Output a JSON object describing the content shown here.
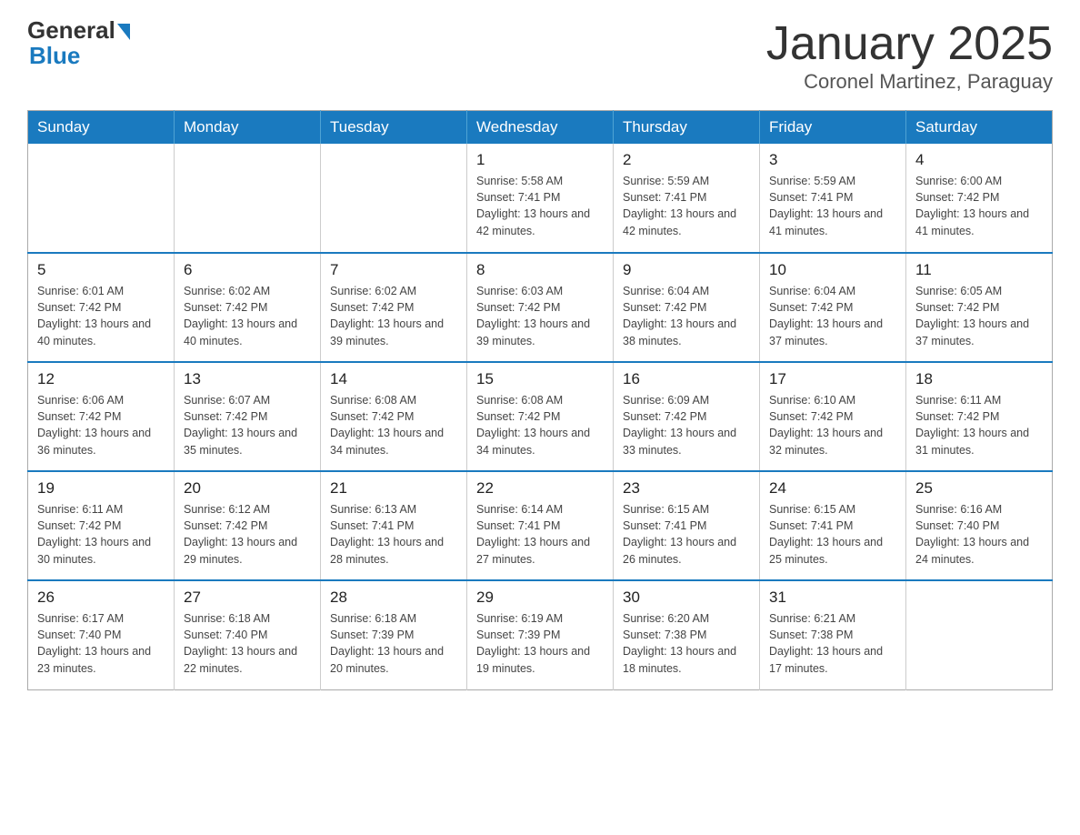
{
  "logo": {
    "general": "General",
    "blue": "Blue"
  },
  "title": "January 2025",
  "subtitle": "Coronel Martinez, Paraguay",
  "days_of_week": [
    "Sunday",
    "Monday",
    "Tuesday",
    "Wednesday",
    "Thursday",
    "Friday",
    "Saturday"
  ],
  "weeks": [
    [
      {
        "day": "",
        "info": ""
      },
      {
        "day": "",
        "info": ""
      },
      {
        "day": "",
        "info": ""
      },
      {
        "day": "1",
        "info": "Sunrise: 5:58 AM\nSunset: 7:41 PM\nDaylight: 13 hours and 42 minutes."
      },
      {
        "day": "2",
        "info": "Sunrise: 5:59 AM\nSunset: 7:41 PM\nDaylight: 13 hours and 42 minutes."
      },
      {
        "day": "3",
        "info": "Sunrise: 5:59 AM\nSunset: 7:41 PM\nDaylight: 13 hours and 41 minutes."
      },
      {
        "day": "4",
        "info": "Sunrise: 6:00 AM\nSunset: 7:42 PM\nDaylight: 13 hours and 41 minutes."
      }
    ],
    [
      {
        "day": "5",
        "info": "Sunrise: 6:01 AM\nSunset: 7:42 PM\nDaylight: 13 hours and 40 minutes."
      },
      {
        "day": "6",
        "info": "Sunrise: 6:02 AM\nSunset: 7:42 PM\nDaylight: 13 hours and 40 minutes."
      },
      {
        "day": "7",
        "info": "Sunrise: 6:02 AM\nSunset: 7:42 PM\nDaylight: 13 hours and 39 minutes."
      },
      {
        "day": "8",
        "info": "Sunrise: 6:03 AM\nSunset: 7:42 PM\nDaylight: 13 hours and 39 minutes."
      },
      {
        "day": "9",
        "info": "Sunrise: 6:04 AM\nSunset: 7:42 PM\nDaylight: 13 hours and 38 minutes."
      },
      {
        "day": "10",
        "info": "Sunrise: 6:04 AM\nSunset: 7:42 PM\nDaylight: 13 hours and 37 minutes."
      },
      {
        "day": "11",
        "info": "Sunrise: 6:05 AM\nSunset: 7:42 PM\nDaylight: 13 hours and 37 minutes."
      }
    ],
    [
      {
        "day": "12",
        "info": "Sunrise: 6:06 AM\nSunset: 7:42 PM\nDaylight: 13 hours and 36 minutes."
      },
      {
        "day": "13",
        "info": "Sunrise: 6:07 AM\nSunset: 7:42 PM\nDaylight: 13 hours and 35 minutes."
      },
      {
        "day": "14",
        "info": "Sunrise: 6:08 AM\nSunset: 7:42 PM\nDaylight: 13 hours and 34 minutes."
      },
      {
        "day": "15",
        "info": "Sunrise: 6:08 AM\nSunset: 7:42 PM\nDaylight: 13 hours and 34 minutes."
      },
      {
        "day": "16",
        "info": "Sunrise: 6:09 AM\nSunset: 7:42 PM\nDaylight: 13 hours and 33 minutes."
      },
      {
        "day": "17",
        "info": "Sunrise: 6:10 AM\nSunset: 7:42 PM\nDaylight: 13 hours and 32 minutes."
      },
      {
        "day": "18",
        "info": "Sunrise: 6:11 AM\nSunset: 7:42 PM\nDaylight: 13 hours and 31 minutes."
      }
    ],
    [
      {
        "day": "19",
        "info": "Sunrise: 6:11 AM\nSunset: 7:42 PM\nDaylight: 13 hours and 30 minutes."
      },
      {
        "day": "20",
        "info": "Sunrise: 6:12 AM\nSunset: 7:42 PM\nDaylight: 13 hours and 29 minutes."
      },
      {
        "day": "21",
        "info": "Sunrise: 6:13 AM\nSunset: 7:41 PM\nDaylight: 13 hours and 28 minutes."
      },
      {
        "day": "22",
        "info": "Sunrise: 6:14 AM\nSunset: 7:41 PM\nDaylight: 13 hours and 27 minutes."
      },
      {
        "day": "23",
        "info": "Sunrise: 6:15 AM\nSunset: 7:41 PM\nDaylight: 13 hours and 26 minutes."
      },
      {
        "day": "24",
        "info": "Sunrise: 6:15 AM\nSunset: 7:41 PM\nDaylight: 13 hours and 25 minutes."
      },
      {
        "day": "25",
        "info": "Sunrise: 6:16 AM\nSunset: 7:40 PM\nDaylight: 13 hours and 24 minutes."
      }
    ],
    [
      {
        "day": "26",
        "info": "Sunrise: 6:17 AM\nSunset: 7:40 PM\nDaylight: 13 hours and 23 minutes."
      },
      {
        "day": "27",
        "info": "Sunrise: 6:18 AM\nSunset: 7:40 PM\nDaylight: 13 hours and 22 minutes."
      },
      {
        "day": "28",
        "info": "Sunrise: 6:18 AM\nSunset: 7:39 PM\nDaylight: 13 hours and 20 minutes."
      },
      {
        "day": "29",
        "info": "Sunrise: 6:19 AM\nSunset: 7:39 PM\nDaylight: 13 hours and 19 minutes."
      },
      {
        "day": "30",
        "info": "Sunrise: 6:20 AM\nSunset: 7:38 PM\nDaylight: 13 hours and 18 minutes."
      },
      {
        "day": "31",
        "info": "Sunrise: 6:21 AM\nSunset: 7:38 PM\nDaylight: 13 hours and 17 minutes."
      },
      {
        "day": "",
        "info": ""
      }
    ]
  ]
}
